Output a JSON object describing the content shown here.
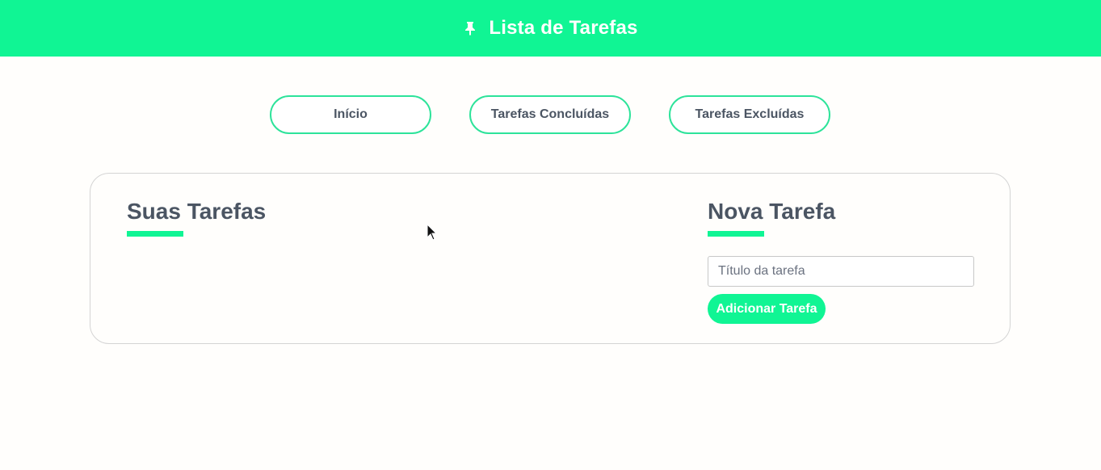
{
  "header": {
    "title": "Lista de Tarefas",
    "icon": "pushpin-icon",
    "background_color": "#10f594"
  },
  "nav": {
    "items": [
      {
        "label": "Início"
      },
      {
        "label": "Tarefas Concluídas"
      },
      {
        "label": "Tarefas Excluídas"
      }
    ]
  },
  "tasks_section": {
    "title": "Suas Tarefas",
    "items": []
  },
  "new_task_section": {
    "title": "Nova Tarefa",
    "input_value": "",
    "input_placeholder": "Título da tarefa",
    "add_button_label": "Adicionar Tarefa"
  },
  "colors": {
    "accent": "#10f594",
    "text": "#4b5563",
    "border": "#d4d4d4"
  }
}
